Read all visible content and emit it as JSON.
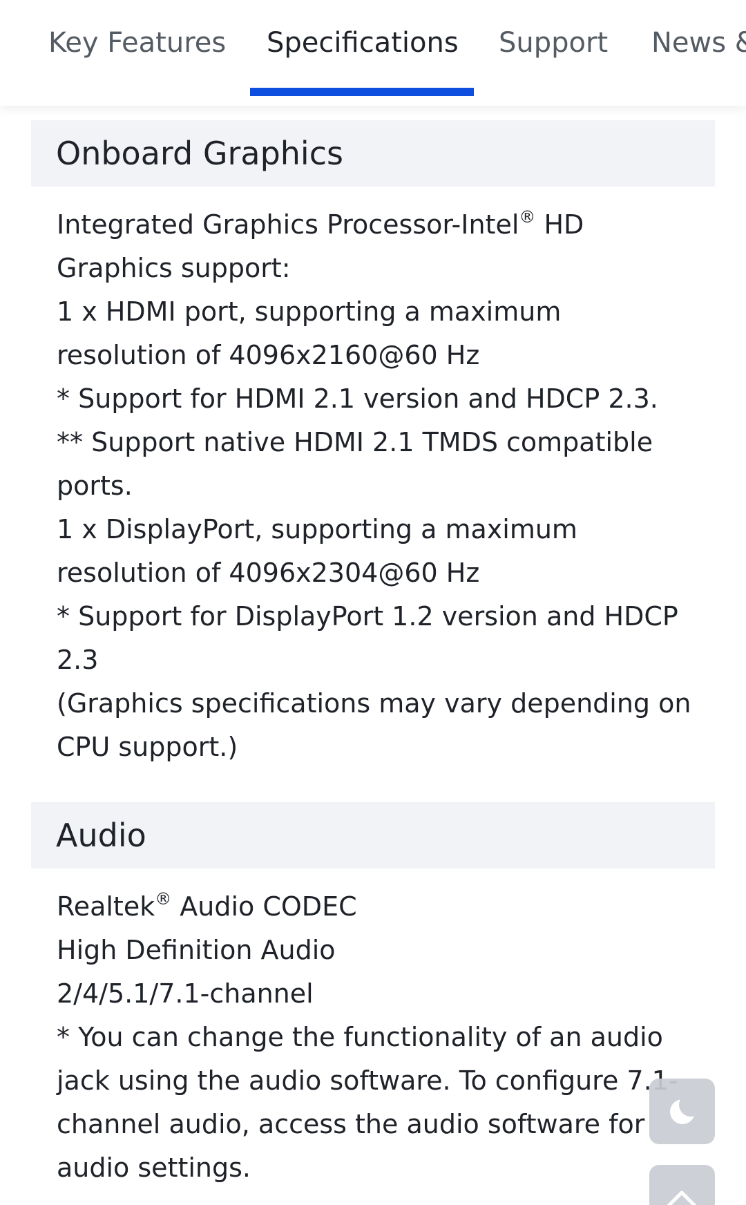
{
  "tabs": [
    {
      "label": "Key Features",
      "active": false
    },
    {
      "label": "Specifications",
      "active": true
    },
    {
      "label": "Support",
      "active": false
    },
    {
      "label": "News & Reviews",
      "active": false
    }
  ],
  "sections": [
    {
      "title": "Onboard Graphics",
      "lines": [
        {
          "text": "Integrated Graphics Processor-Intel",
          "sup": "®",
          "after": " HD"
        },
        {
          "text": "Graphics support:"
        },
        {
          "text": "1 x HDMI port, supporting a maximum"
        },
        {
          "text": "resolution of 4096x2160@60 Hz"
        },
        {
          "text": "* Support for HDMI 2.1 version and HDCP 2.3."
        },
        {
          "text": "** Support native HDMI 2.1 TMDS compatible"
        },
        {
          "text": "ports."
        },
        {
          "text": "1 x DisplayPort, supporting a maximum"
        },
        {
          "text": "resolution of 4096x2304@60 Hz"
        },
        {
          "text": "* Support for DisplayPort 1.2 version and HDCP"
        },
        {
          "text": "2.3"
        },
        {
          "text": "(Graphics specifications may vary depending on"
        },
        {
          "text": "CPU support.)"
        }
      ]
    },
    {
      "title": "Audio",
      "lines": [
        {
          "text": "Realtek",
          "sup": "®",
          "after": " Audio CODEC"
        },
        {
          "text": "High Definition Audio"
        },
        {
          "text": "2/4/5.1/7.1-channel"
        },
        {
          "text": "* You can change the functionality of an audio"
        },
        {
          "text": "jack using the audio software. To configure 7.1-"
        },
        {
          "text": "channel audio, access the audio software for"
        },
        {
          "text": "audio settings."
        }
      ]
    }
  ],
  "floating_buttons": {
    "dark_mode_icon": "moon-icon",
    "back_to_top_icon": "chevron-up-icon"
  },
  "colors": {
    "accent": "#0f4fe0",
    "section_header_bg": "#f2f3f7",
    "floating_button_bg": "#c9cdd3"
  }
}
